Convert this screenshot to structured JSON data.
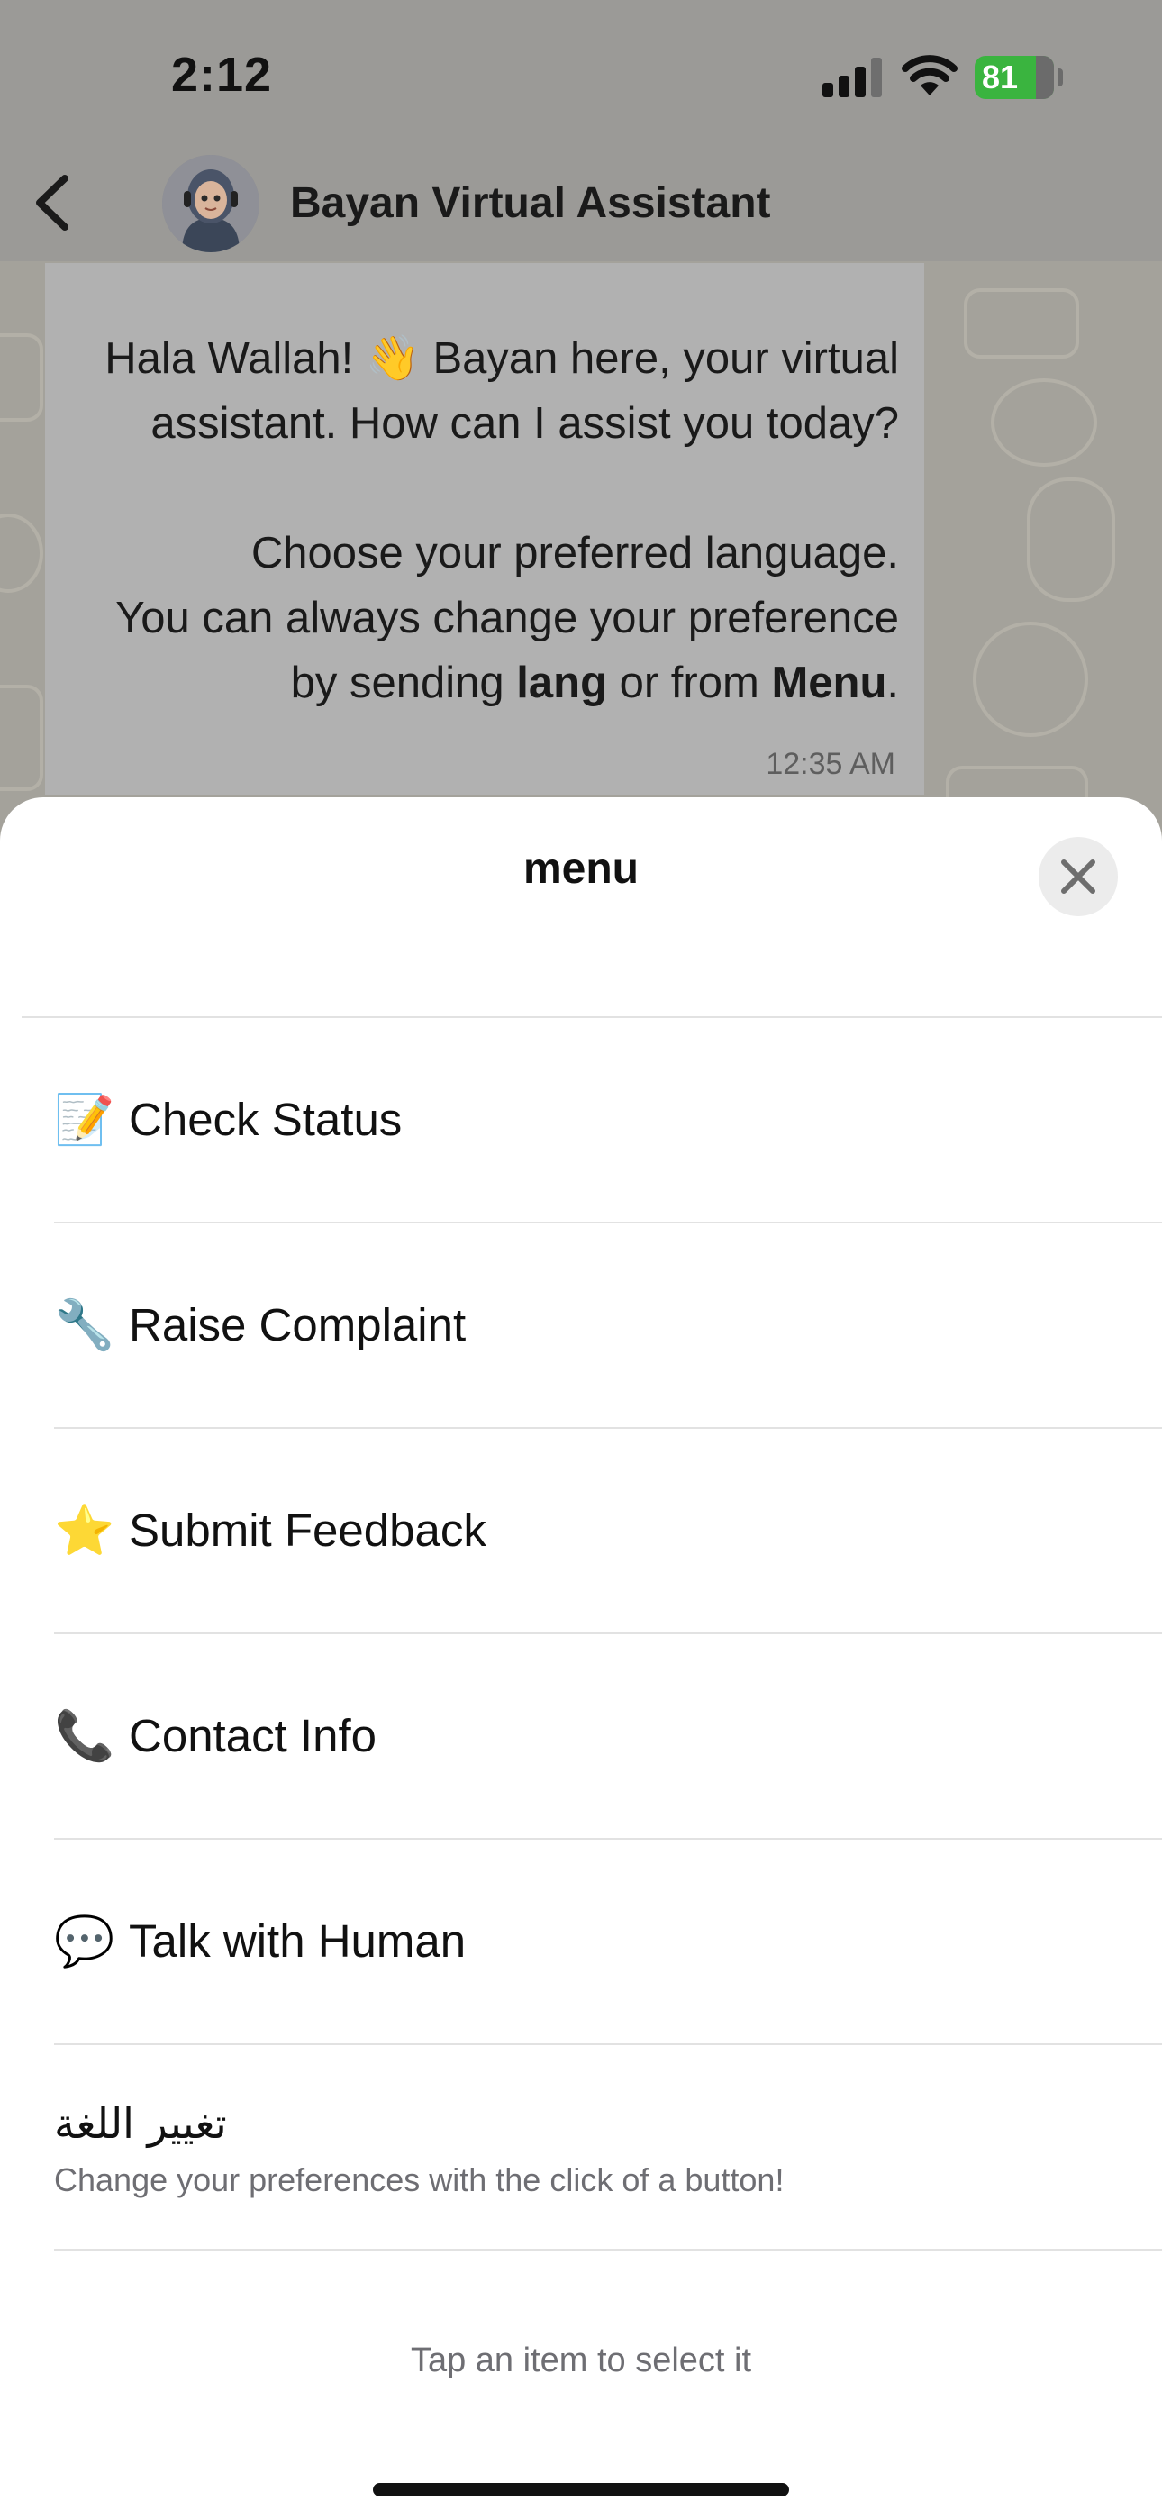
{
  "status_bar": {
    "time": "2:12",
    "battery_level": "81",
    "icons": [
      "cellular-signal-icon",
      "wifi-icon",
      "battery-charging-icon"
    ]
  },
  "chat_header": {
    "back_icon": "chevron-left-icon",
    "title": "Bayan Virtual Assistant"
  },
  "message": {
    "line1": "Hala Wallah! 👋 Bayan here, your virtual",
    "line2": "assistant. How can I assist you today?",
    "line3": "Choose your preferred language.",
    "line4": "You can always change your preference",
    "line5_pre": "by sending ",
    "line5_bold1": "lang",
    "line5_mid": " or from ",
    "line5_bold2": "Menu",
    "line5_post": ".",
    "time": "12:35 AM"
  },
  "sheet": {
    "title": "menu",
    "close_icon": "close-icon",
    "items": [
      {
        "emoji": "📝",
        "label": "Check Status"
      },
      {
        "emoji": "🔧",
        "label": "Raise Complaint"
      },
      {
        "emoji": "⭐",
        "label": "Submit Feedback"
      },
      {
        "emoji": "📞",
        "label": "Contact Info"
      },
      {
        "emoji": "💬",
        "label": "Talk with Human"
      },
      {
        "label": "تغيير اللغة",
        "description": "Change your preferences with the click of a button!"
      }
    ],
    "hint": "Tap an item to select it"
  },
  "colors": {
    "dim_overlay": "#9b9a97",
    "bubble": "#b1b1b1",
    "battery": "#3ab43f",
    "sheet_bg": "#ffffff",
    "divider": "#e2e2e2",
    "secondary_text": "#6e6e73"
  }
}
